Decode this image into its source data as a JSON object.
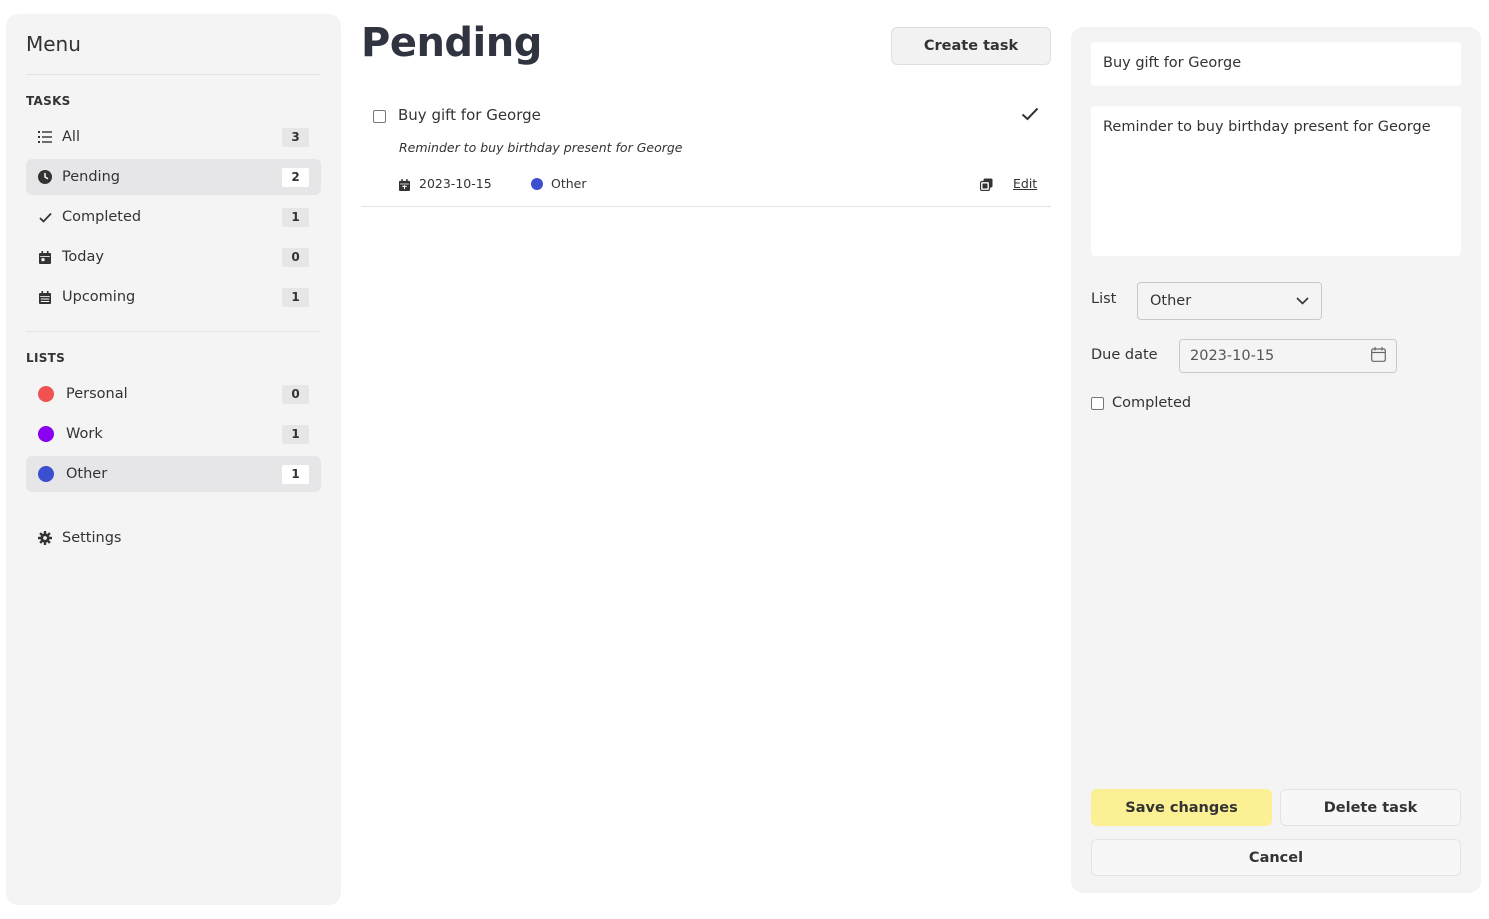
{
  "sidebar": {
    "title": "Menu",
    "tasks_label": "TASKS",
    "tasks": [
      {
        "label": "All",
        "count": "3",
        "icon": "list-icon"
      },
      {
        "label": "Pending",
        "count": "2",
        "icon": "clock-icon",
        "active": true
      },
      {
        "label": "Completed",
        "count": "1",
        "icon": "check-icon"
      },
      {
        "label": "Today",
        "count": "0",
        "icon": "calendar-day-icon"
      },
      {
        "label": "Upcoming",
        "count": "1",
        "icon": "calendar-icon"
      }
    ],
    "lists_label": "LISTS",
    "lists": [
      {
        "label": "Personal",
        "count": "0",
        "color": "#f05252"
      },
      {
        "label": "Work",
        "count": "1",
        "color": "#8b00f0"
      },
      {
        "label": "Other",
        "count": "1",
        "color": "#3b4fcf",
        "active": true
      }
    ],
    "settings_label": "Settings"
  },
  "main": {
    "title": "Pending",
    "create_button": "Create task",
    "tasks": [
      {
        "title": "Buy gift for George",
        "description": "Reminder to buy birthday present for George",
        "due_date": "2023-10-15",
        "list": "Other",
        "list_color": "#3b4fcf",
        "edit_label": "Edit"
      }
    ]
  },
  "editor": {
    "title_value": "Buy gift for George",
    "description_value": "Reminder to buy birthday present for George",
    "list_label": "List",
    "list_value": "Other",
    "due_label": "Due date",
    "due_value": "2023-10-15",
    "completed_label": "Completed",
    "save_button": "Save changes",
    "delete_button": "Delete task",
    "cancel_button": "Cancel"
  }
}
